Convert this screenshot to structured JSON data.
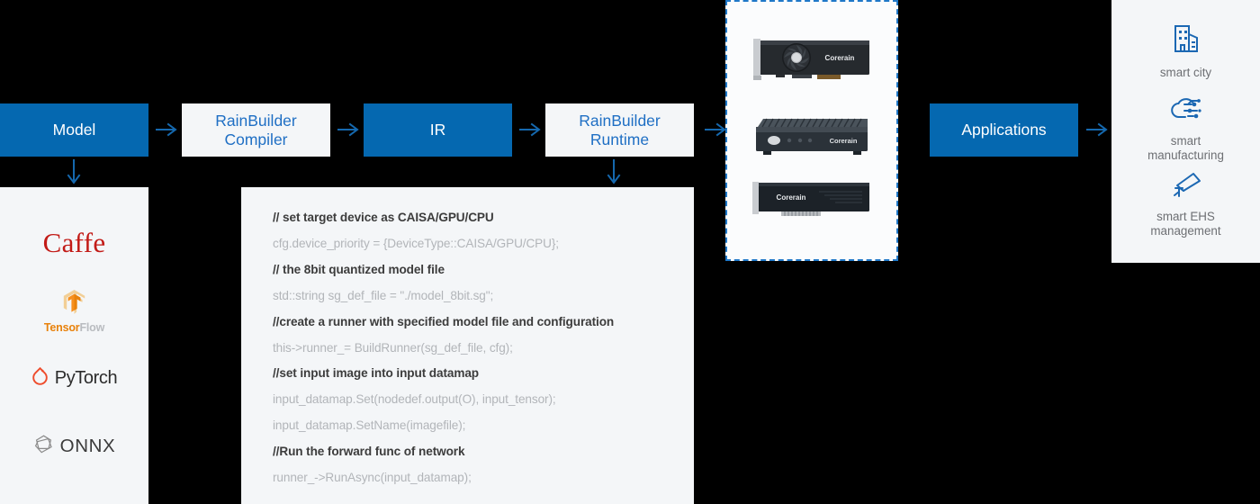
{
  "theme": {
    "accent_blue": "#0568b0",
    "arrow_blue": "#1568ae",
    "outline_text_blue": "#1f6fc4",
    "panel_bg": "#f4f6f8",
    "dashed_border": "#1f78c8",
    "code_comment": "#3c3c3c",
    "code_stmt": "#b2b5b9",
    "page_bg": "#000000"
  },
  "flow": {
    "boxes": [
      {
        "label": "Model",
        "style": "filled"
      },
      {
        "label": "RainBuilder\nCompiler",
        "style": "outline"
      },
      {
        "label": "IR",
        "style": "filled"
      },
      {
        "label": "RainBuilder\nRuntime",
        "style": "outline"
      },
      {
        "label": "Applications",
        "style": "filled"
      }
    ],
    "arrows": {
      "right": "arrow-right-icon",
      "down": "arrow-down-icon"
    }
  },
  "frameworks": {
    "items": [
      {
        "name": "Caffe",
        "logo": "caffe-logo"
      },
      {
        "name": "TensorFlow",
        "name_part_a": "Tensor",
        "name_part_b": "Flow",
        "logo": "tensorflow-logo"
      },
      {
        "name": "PyTorch",
        "logo": "pytorch-logo"
      },
      {
        "name": "ONNX",
        "logo": "onnx-logo"
      }
    ]
  },
  "code": {
    "lines": [
      {
        "type": "comment",
        "text": "// set target device as CAISA/GPU/CPU"
      },
      {
        "type": "stmt",
        "text": "cfg.device_priority = {DeviceType::CAISA/GPU/CPU};"
      },
      {
        "type": "comment",
        "text": "// the 8bit quantized model file"
      },
      {
        "type": "stmt",
        "text": "std::string sg_def_file = \"./model_8bit.sg\";"
      },
      {
        "type": "comment",
        "text": "//create a runner with specified model file and configuration"
      },
      {
        "type": "stmt",
        "text": "this->runner_= BuildRunner(sg_def_file, cfg);"
      },
      {
        "type": "comment",
        "text": "//set input image into input datamap"
      },
      {
        "type": "stmt",
        "text": "input_datamap.Set(nodedef.output(O), input_tensor);"
      },
      {
        "type": "stmt",
        "text": "input_datamap.SetName(imagefile);"
      },
      {
        "type": "comment",
        "text": "//Run the forward func of network"
      },
      {
        "type": "stmt",
        "text": "runner_->RunAsync(input_datamap);"
      }
    ]
  },
  "hardware": {
    "items": [
      {
        "product": "Corerain",
        "type": "pcie-accelerator-card-with-fan"
      },
      {
        "product": "Corerain",
        "type": "edge-computing-box"
      },
      {
        "product": "Corerain",
        "type": "pcie-accelerator-card-passive"
      }
    ]
  },
  "applications": {
    "items": [
      {
        "label": "smart city",
        "icon": "building-icon"
      },
      {
        "label": "smart\nmanufacturing",
        "icon": "cloud-circuit-icon"
      },
      {
        "label": "smart EHS\nmanagement",
        "icon": "security-camera-icon"
      }
    ]
  }
}
